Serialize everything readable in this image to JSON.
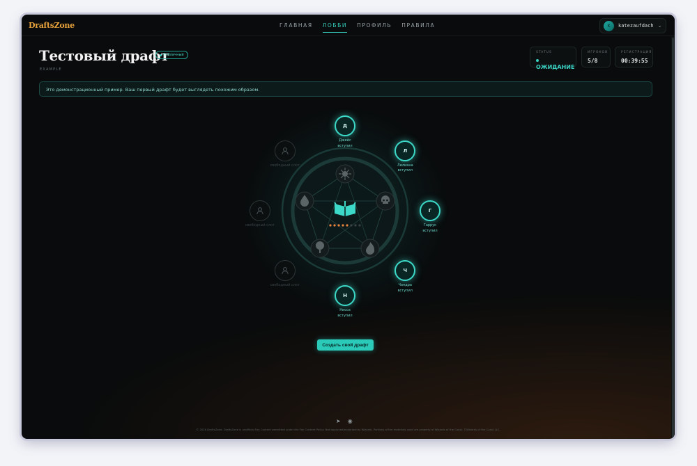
{
  "nav": {
    "logo": "DraftsZone",
    "links": [
      "ГЛАВНАЯ",
      "ЛОББИ",
      "ПРОФИЛЬ",
      "ПРАВИЛА"
    ],
    "active_link": "ЛОББИ",
    "user": {
      "initial": "K",
      "name": "katezaufdach"
    }
  },
  "header": {
    "title": "Тестовый драфт",
    "badge": "Публичный",
    "subtitle": "EXAMPLE"
  },
  "stats": {
    "status": {
      "label": "STATUS",
      "value": "ОЖИДАНИЕ"
    },
    "players": {
      "label": "ИГРОКОВ",
      "value": "5/8"
    },
    "registration": {
      "label": "РЕГИСТРАЦИЯ",
      "value": "00:39:55"
    }
  },
  "notice": "Это демонстрационный пример. Ваш первый драфт будет выглядеть похожим образом.",
  "seats": [
    {
      "initial": "Д",
      "name": "Джейс",
      "status": "вступил"
    },
    {
      "initial": "Л",
      "name": "Лилиана",
      "status": "вступил"
    },
    {
      "initial": "Г",
      "name": "Гаррук",
      "status": "вступил"
    },
    {
      "initial": "Ч",
      "name": "Чандра",
      "status": "вступил"
    },
    {
      "initial": "Н",
      "name": "Нисса",
      "status": "вступил"
    },
    {
      "initial": "",
      "name": "свободный слот",
      "status": ""
    },
    {
      "initial": "",
      "name": "свободный слот",
      "status": ""
    },
    {
      "initial": "",
      "name": "свободный слот",
      "status": ""
    }
  ],
  "progress": {
    "filled": 5,
    "total": 8
  },
  "colors": {
    "accent": "#38d0c0",
    "logo": "#e8a23c",
    "progress_dot": "#e8843c"
  },
  "cta": "Создать свой драфт",
  "footer": {
    "icons": [
      "telegram-icon",
      "discord-icon"
    ],
    "copyright": "© 2026 DraftsZone. DraftsZone is unofficial Fan Content permitted under the Fan Content Policy. Not approved/endorsed by Wizards. Portions of the materials used are property of Wizards of the Coast. ©Wizards of the Coast LLC."
  }
}
